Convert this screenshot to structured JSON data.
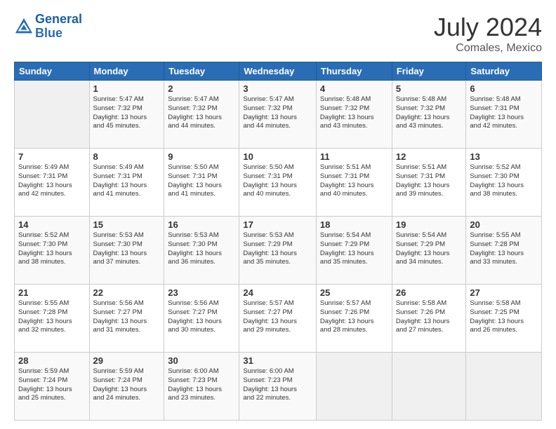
{
  "header": {
    "logo_line1": "General",
    "logo_line2": "Blue",
    "title": "July 2024",
    "location": "Comales, Mexico"
  },
  "columns": [
    "Sunday",
    "Monday",
    "Tuesday",
    "Wednesday",
    "Thursday",
    "Friday",
    "Saturday"
  ],
  "weeks": [
    [
      {
        "day": "",
        "info": ""
      },
      {
        "day": "1",
        "info": "Sunrise: 5:47 AM\nSunset: 7:32 PM\nDaylight: 13 hours\nand 45 minutes."
      },
      {
        "day": "2",
        "info": "Sunrise: 5:47 AM\nSunset: 7:32 PM\nDaylight: 13 hours\nand 44 minutes."
      },
      {
        "day": "3",
        "info": "Sunrise: 5:47 AM\nSunset: 7:32 PM\nDaylight: 13 hours\nand 44 minutes."
      },
      {
        "day": "4",
        "info": "Sunrise: 5:48 AM\nSunset: 7:32 PM\nDaylight: 13 hours\nand 43 minutes."
      },
      {
        "day": "5",
        "info": "Sunrise: 5:48 AM\nSunset: 7:32 PM\nDaylight: 13 hours\nand 43 minutes."
      },
      {
        "day": "6",
        "info": "Sunrise: 5:48 AM\nSunset: 7:31 PM\nDaylight: 13 hours\nand 42 minutes."
      }
    ],
    [
      {
        "day": "7",
        "info": "Sunrise: 5:49 AM\nSunset: 7:31 PM\nDaylight: 13 hours\nand 42 minutes."
      },
      {
        "day": "8",
        "info": "Sunrise: 5:49 AM\nSunset: 7:31 PM\nDaylight: 13 hours\nand 41 minutes."
      },
      {
        "day": "9",
        "info": "Sunrise: 5:50 AM\nSunset: 7:31 PM\nDaylight: 13 hours\nand 41 minutes."
      },
      {
        "day": "10",
        "info": "Sunrise: 5:50 AM\nSunset: 7:31 PM\nDaylight: 13 hours\nand 40 minutes."
      },
      {
        "day": "11",
        "info": "Sunrise: 5:51 AM\nSunset: 7:31 PM\nDaylight: 13 hours\nand 40 minutes."
      },
      {
        "day": "12",
        "info": "Sunrise: 5:51 AM\nSunset: 7:31 PM\nDaylight: 13 hours\nand 39 minutes."
      },
      {
        "day": "13",
        "info": "Sunrise: 5:52 AM\nSunset: 7:30 PM\nDaylight: 13 hours\nand 38 minutes."
      }
    ],
    [
      {
        "day": "14",
        "info": "Sunrise: 5:52 AM\nSunset: 7:30 PM\nDaylight: 13 hours\nand 38 minutes."
      },
      {
        "day": "15",
        "info": "Sunrise: 5:53 AM\nSunset: 7:30 PM\nDaylight: 13 hours\nand 37 minutes."
      },
      {
        "day": "16",
        "info": "Sunrise: 5:53 AM\nSunset: 7:30 PM\nDaylight: 13 hours\nand 36 minutes."
      },
      {
        "day": "17",
        "info": "Sunrise: 5:53 AM\nSunset: 7:29 PM\nDaylight: 13 hours\nand 35 minutes."
      },
      {
        "day": "18",
        "info": "Sunrise: 5:54 AM\nSunset: 7:29 PM\nDaylight: 13 hours\nand 35 minutes."
      },
      {
        "day": "19",
        "info": "Sunrise: 5:54 AM\nSunset: 7:29 PM\nDaylight: 13 hours\nand 34 minutes."
      },
      {
        "day": "20",
        "info": "Sunrise: 5:55 AM\nSunset: 7:28 PM\nDaylight: 13 hours\nand 33 minutes."
      }
    ],
    [
      {
        "day": "21",
        "info": "Sunrise: 5:55 AM\nSunset: 7:28 PM\nDaylight: 13 hours\nand 32 minutes."
      },
      {
        "day": "22",
        "info": "Sunrise: 5:56 AM\nSunset: 7:27 PM\nDaylight: 13 hours\nand 31 minutes."
      },
      {
        "day": "23",
        "info": "Sunrise: 5:56 AM\nSunset: 7:27 PM\nDaylight: 13 hours\nand 30 minutes."
      },
      {
        "day": "24",
        "info": "Sunrise: 5:57 AM\nSunset: 7:27 PM\nDaylight: 13 hours\nand 29 minutes."
      },
      {
        "day": "25",
        "info": "Sunrise: 5:57 AM\nSunset: 7:26 PM\nDaylight: 13 hours\nand 28 minutes."
      },
      {
        "day": "26",
        "info": "Sunrise: 5:58 AM\nSunset: 7:26 PM\nDaylight: 13 hours\nand 27 minutes."
      },
      {
        "day": "27",
        "info": "Sunrise: 5:58 AM\nSunset: 7:25 PM\nDaylight: 13 hours\nand 26 minutes."
      }
    ],
    [
      {
        "day": "28",
        "info": "Sunrise: 5:59 AM\nSunset: 7:24 PM\nDaylight: 13 hours\nand 25 minutes."
      },
      {
        "day": "29",
        "info": "Sunrise: 5:59 AM\nSunset: 7:24 PM\nDaylight: 13 hours\nand 24 minutes."
      },
      {
        "day": "30",
        "info": "Sunrise: 6:00 AM\nSunset: 7:23 PM\nDaylight: 13 hours\nand 23 minutes."
      },
      {
        "day": "31",
        "info": "Sunrise: 6:00 AM\nSunset: 7:23 PM\nDaylight: 13 hours\nand 22 minutes."
      },
      {
        "day": "",
        "info": ""
      },
      {
        "day": "",
        "info": ""
      },
      {
        "day": "",
        "info": ""
      }
    ]
  ]
}
